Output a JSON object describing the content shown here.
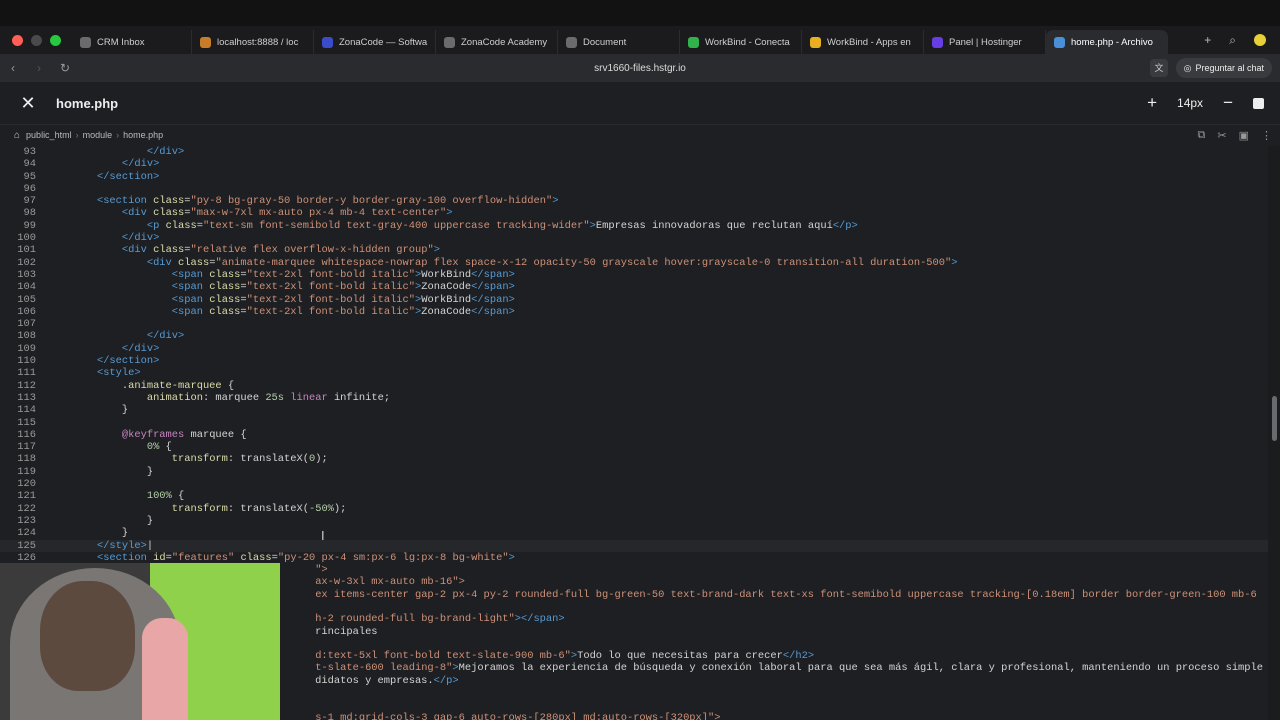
{
  "browser": {
    "tabs": [
      {
        "label": "CRM Inbox",
        "color": "#6b6b6b"
      },
      {
        "label": "localhost:8888 / loc",
        "color": "#c77c2a"
      },
      {
        "label": "ZonaCode — Softwa",
        "color": "#3b4cca"
      },
      {
        "label": "ZonaCode Academy",
        "color": "#6b6b6b"
      },
      {
        "label": "Document",
        "color": "#6b6b6b"
      },
      {
        "label": "WorkBind - Conecta",
        "color": "#2fb34a"
      },
      {
        "label": "WorkBind - Apps en",
        "color": "#e8b020"
      },
      {
        "label": "Panel | Hostinger",
        "color": "#673de6"
      },
      {
        "label": "home.php - Archivo",
        "color": "#4a90d9"
      }
    ],
    "url": "srv1660-files.hstgr.io",
    "ask_chat": "Preguntar al chat"
  },
  "editor_header": {
    "file_name": "home.php",
    "font_size": "14px"
  },
  "breadcrumb": [
    "public_html",
    "module",
    "home.php"
  ],
  "code_lines": [
    {
      "n": "93",
      "html": "            <span class=\"t\">&lt;/div&gt;</span>"
    },
    {
      "n": "94",
      "html": "        <span class=\"t\">&lt;/div&gt;</span>"
    },
    {
      "n": "95",
      "html": "    <span class=\"t\">&lt;/section&gt;</span>"
    },
    {
      "n": "96",
      "html": ""
    },
    {
      "n": "97",
      "html": "    <span class=\"t\">&lt;section</span> <span class=\"a\">class</span>=<span class=\"s\">\"py-8 bg-gray-50 border-y border-gray-100 overflow-hidden\"</span><span class=\"t\">&gt;</span>"
    },
    {
      "n": "98",
      "html": "        <span class=\"t\">&lt;div</span> <span class=\"a\">class</span>=<span class=\"s\">\"max-w-7xl mx-auto px-4 mb-4 text-center\"</span><span class=\"t\">&gt;</span>"
    },
    {
      "n": "99",
      "html": "            <span class=\"t\">&lt;p</span> <span class=\"a\">class</span>=<span class=\"s\">\"text-sm font-semibold text-gray-400 uppercase tracking-wider\"</span><span class=\"t\">&gt;</span>Empresas innovadoras que reclutan aquí<span class=\"t\">&lt;/p&gt;</span>"
    },
    {
      "n": "100",
      "html": "        <span class=\"t\">&lt;/div&gt;</span>"
    },
    {
      "n": "101",
      "html": "        <span class=\"t\">&lt;div</span> <span class=\"a\">class</span>=<span class=\"s\">\"relative flex overflow-x-hidden group\"</span><span class=\"t\">&gt;</span>"
    },
    {
      "n": "102",
      "html": "            <span class=\"t\">&lt;div</span> <span class=\"a\">class</span>=<span class=\"s\">\"animate-marquee whitespace-nowrap flex space-x-12 opacity-50 grayscale hover:grayscale-0 transition-all duration-500\"</span><span class=\"t\">&gt;</span>"
    },
    {
      "n": "103",
      "html": "                <span class=\"t\">&lt;span</span> <span class=\"a\">class</span>=<span class=\"s\">\"text-2xl font-bold italic\"</span><span class=\"t\">&gt;</span>WorkBind<span class=\"t\">&lt;/span&gt;</span>"
    },
    {
      "n": "104",
      "html": "                <span class=\"t\">&lt;span</span> <span class=\"a\">class</span>=<span class=\"s\">\"text-2xl font-bold italic\"</span><span class=\"t\">&gt;</span>ZonaCode<span class=\"t\">&lt;/span&gt;</span>"
    },
    {
      "n": "105",
      "html": "                <span class=\"t\">&lt;span</span> <span class=\"a\">class</span>=<span class=\"s\">\"text-2xl font-bold italic\"</span><span class=\"t\">&gt;</span>WorkBind<span class=\"t\">&lt;/span&gt;</span>"
    },
    {
      "n": "106",
      "html": "                <span class=\"t\">&lt;span</span> <span class=\"a\">class</span>=<span class=\"s\">\"text-2xl font-bold italic\"</span><span class=\"t\">&gt;</span>ZonaCode<span class=\"t\">&lt;/span&gt;</span>"
    },
    {
      "n": "107",
      "html": ""
    },
    {
      "n": "108",
      "html": "            <span class=\"t\">&lt;/div&gt;</span>"
    },
    {
      "n": "109",
      "html": "        <span class=\"t\">&lt;/div&gt;</span>"
    },
    {
      "n": "110",
      "html": "    <span class=\"t\">&lt;/section&gt;</span>"
    },
    {
      "n": "111",
      "html": "    <span class=\"t\">&lt;style&gt;</span>"
    },
    {
      "n": "112",
      "html": "        <span class=\"a\">.animate-marquee</span> {"
    },
    {
      "n": "113",
      "html": "            <span class=\"a\">animation</span>: marquee <span class=\"n\">25s</span> <span class=\"k\">linear</span> infinite;"
    },
    {
      "n": "114",
      "html": "        }"
    },
    {
      "n": "115",
      "html": ""
    },
    {
      "n": "116",
      "html": "        <span class=\"k\">@keyframes</span> marquee {"
    },
    {
      "n": "117",
      "html": "            <span class=\"n\">0%</span> {"
    },
    {
      "n": "118",
      "html": "                <span class=\"a\">transform</span>: translateX(<span class=\"n\">0</span>);"
    },
    {
      "n": "119",
      "html": "            }"
    },
    {
      "n": "120",
      "html": ""
    },
    {
      "n": "121",
      "html": "            <span class=\"n\">100%</span> {"
    },
    {
      "n": "122",
      "html": "                <span class=\"a\">transform</span>: translateX(<span class=\"n\">-50%</span>);"
    },
    {
      "n": "123",
      "html": "            }"
    },
    {
      "n": "124",
      "html": "        }"
    },
    {
      "n": "125",
      "html": "    <span class=\"t\">&lt;/style&gt;</span>|",
      "current": true
    },
    {
      "n": "126",
      "html": "    <span class=\"t\">&lt;section</span> <span class=\"a\">id</span>=<span class=\"s\">\"features\"</span> <span class=\"a\">class</span>=<span class=\"s\">\"py-20 px-4 sm:px-6 lg:px-8 bg-white\"</span><span class=\"t\">&gt;</span>"
    },
    {
      "n": "",
      "html": "                                       <span class=\"s\">\"&gt;</span>"
    },
    {
      "n": "",
      "html": "                                       <span class=\"s\">ax-w-3xl mx-auto mb-16\"&gt;</span>"
    },
    {
      "n": "",
      "html": "                                       <span class=\"s\">ex items-center gap-2 px-4 py-2 rounded-full bg-green-50 text-brand-dark text-xs font-semibold uppercase tracking-[0.18em] border border-green-100 mb-6</span>"
    },
    {
      "n": "",
      "html": ""
    },
    {
      "n": "",
      "html": "                                       <span class=\"s\">h-2 rounded-full bg-brand-light\"</span><span class=\"t\">&gt;&lt;/span&gt;</span>"
    },
    {
      "n": "",
      "html": "                                       rincipales"
    },
    {
      "n": "",
      "html": ""
    },
    {
      "n": "",
      "html": "                                       <span class=\"s\">d:text-5xl font-bold text-slate-900 mb-6\"</span><span class=\"t\">&gt;</span>Todo lo que necesitas para crecer<span class=\"t\">&lt;/h2&gt;</span>"
    },
    {
      "n": "",
      "html": "                                       <span class=\"s\">t-slate-600 leading-8\"</span><span class=\"t\">&gt;</span>Mejoramos la experiencia de búsqueda y conexión laboral para que sea más ágil, clara y profesional, manteniendo un proceso simple y"
    },
    {
      "n": "",
      "html": "                                       didatos y empresas.<span class=\"t\">&lt;/p&gt;</span>"
    },
    {
      "n": "",
      "html": ""
    },
    {
      "n": "",
      "html": ""
    },
    {
      "n": "",
      "html": "                                       <span class=\"s\">s-1 md:grid-cols-3 gap-6 auto-rows-[280px] md:auto-rows-[320px]\"&gt;</span>"
    }
  ]
}
